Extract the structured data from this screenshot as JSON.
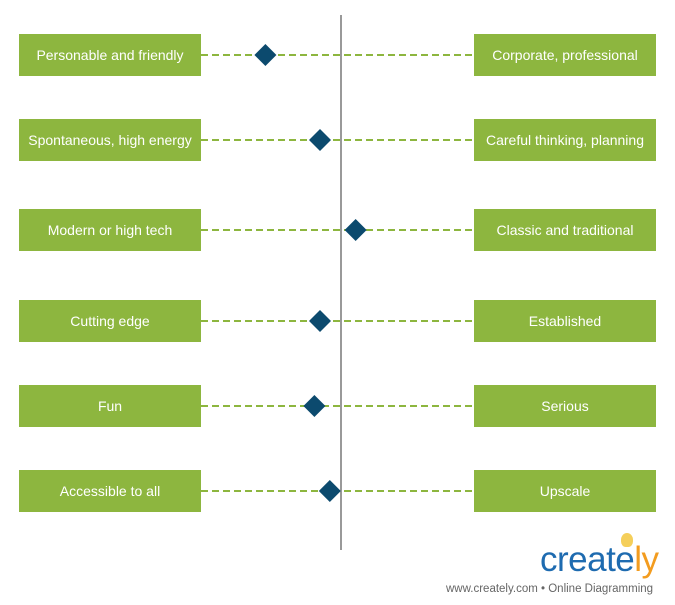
{
  "colors": {
    "box": "#8db63f",
    "marker": "#0c4a6e",
    "axis": "#999999",
    "dash": "#8db63f"
  },
  "scale_note_range": [
    -1,
    1
  ],
  "rows": [
    {
      "left": "Personable and friendly",
      "right": "Corporate, professional",
      "value": -0.54
    },
    {
      "left": "Spontaneous, high energy",
      "right": "Careful thinking, planning",
      "value": -0.15
    },
    {
      "left": "Modern or high tech",
      "right": "Classic and traditional",
      "value": 0.11
    },
    {
      "left": "Cutting edge",
      "right": "Established",
      "value": -0.15
    },
    {
      "left": "Fun",
      "right": "Serious",
      "value": -0.19
    },
    {
      "left": "Accessible to all",
      "right": "Upscale",
      "value": -0.08
    }
  ],
  "branding": {
    "logo_main": "create",
    "logo_accent": "ly",
    "tagline": "www.creately.com • Online Diagramming"
  }
}
